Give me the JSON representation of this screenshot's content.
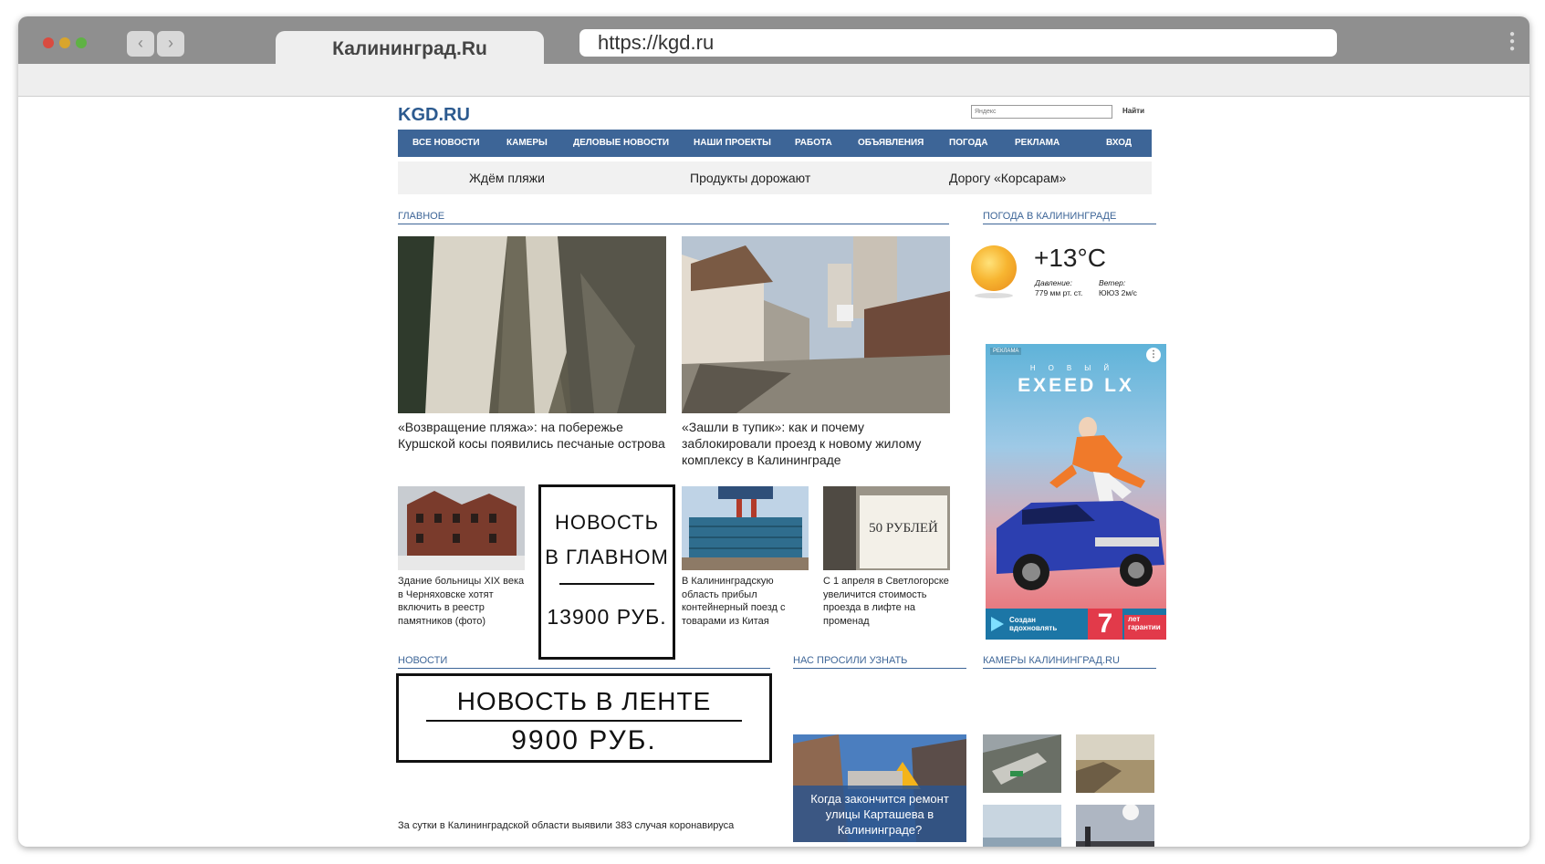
{
  "browser": {
    "tab_title": "Калининград.Ru",
    "url": "https://kgd.ru",
    "back_icon": "chevron-left-icon",
    "forward_icon": "chevron-right-icon"
  },
  "header": {
    "logo": "KGD.RU",
    "search_placeholder": "Яндекс",
    "search_button": "Найти"
  },
  "nav": {
    "items": [
      {
        "label": "ВСЕ НОВОСТИ"
      },
      {
        "label": "КАМЕРЫ"
      },
      {
        "label": "ДЕЛОВЫЕ НОВОСТИ"
      },
      {
        "label": "НАШИ ПРОЕКТЫ"
      },
      {
        "label": "РАБОТА"
      },
      {
        "label": "ОБЪЯВЛЕНИЯ"
      },
      {
        "label": "ПОГОДА"
      },
      {
        "label": "РЕКЛАМА"
      },
      {
        "label": "ВХОД"
      }
    ]
  },
  "trends": [
    "Ждём пляжи",
    "Продукты дорожают",
    "Дорогу «Корсарам»"
  ],
  "main": {
    "title": "ГЛАВНОЕ",
    "big_stories": [
      {
        "caption": "«Возвращение пляжа»: на побережье Куршской косы появились песчаные острова"
      },
      {
        "caption": "«Зашли в тупик»: как и почему заблокировали проезд к новому жилому комплексу в Калининграде"
      }
    ],
    "small_stories": [
      {
        "caption": "Здание больницы XIX века в Черняховске хотят включить в реестр памятников (фото)"
      },
      {
        "caption": "В Калининградскую область прибыл контейнерный поезд с товарами из Китая"
      },
      {
        "caption": "С 1 апреля в Светлогорске увеличится стоимость проезда в лифте на променад"
      }
    ],
    "small_photo_sign": "50 РУБЛЕЙ",
    "ad_slot": {
      "line1": "НОВОСТЬ",
      "line2": "В ГЛАВНОМ",
      "price": "13900 РУБ."
    }
  },
  "weather": {
    "title": "ПОГОДА В КАЛИНИНГРАДЕ",
    "temperature": "+13°C",
    "pressure_label": "Давление:",
    "pressure_value": "779 мм рт. ст.",
    "wind_label": "Ветер:",
    "wind_value": "ЮЮЗ 2м/с"
  },
  "banner": {
    "tag": "РЕКЛАМА",
    "subtitle": "НОВЫЙ",
    "title": "EXEED LX",
    "footer_left": "Создан вдохновлять",
    "footer_number": "7",
    "footer_right": "лет гарантии"
  },
  "news": {
    "title": "НОВОСТИ",
    "ad_slot": {
      "line1": "НОВОСТЬ В ЛЕНТЕ",
      "price": "9900 РУБ."
    },
    "items": [
      {
        "text": "За сутки в Калининградской области выявили 383 случая коронавируса"
      }
    ]
  },
  "asked": {
    "title": "НАС ПРОСИЛИ УЗНАТЬ",
    "card": "Когда закончится ремонт улицы Карташева в Калининграде?"
  },
  "cameras": {
    "title": "КАМЕРЫ КАЛИНИНГРАД.RU"
  }
}
